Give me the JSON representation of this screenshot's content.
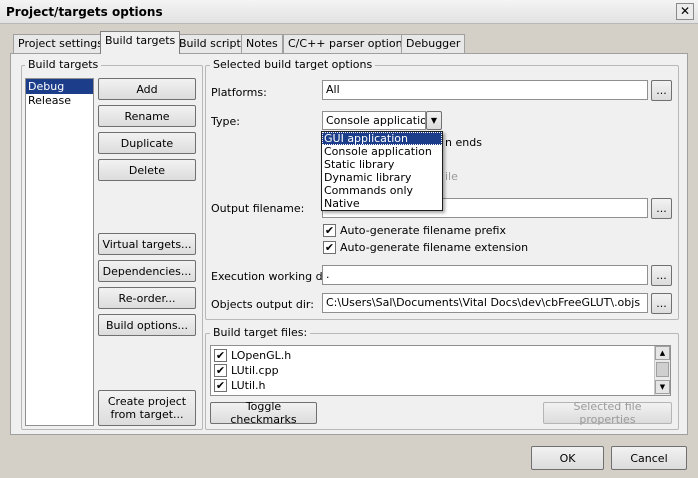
{
  "window": {
    "title": "Project/targets options",
    "close_glyph": "✕"
  },
  "tabs": [
    {
      "label": "Project settings"
    },
    {
      "label": "Build targets"
    },
    {
      "label": "Build scripts"
    },
    {
      "label": "Notes"
    },
    {
      "label": "C/C++ parser options"
    },
    {
      "label": "Debugger"
    }
  ],
  "build_targets": {
    "group_label": "Build targets",
    "items": [
      "Debug",
      "Release"
    ],
    "buttons": {
      "add": "Add",
      "rename": "Rename",
      "duplicate": "Duplicate",
      "delete": "Delete",
      "virtual_targets": "Virtual targets...",
      "dependencies": "Dependencies...",
      "reorder": "Re-order...",
      "build_options": "Build options...",
      "create_line1": "Create project",
      "create_line2": "from target..."
    }
  },
  "selected": {
    "group_label": "Selected build target options",
    "platforms_label": "Platforms:",
    "platforms_value": "All",
    "type_label": "Type:",
    "type_value": "Console application",
    "dropdown_options": [
      "GUI application",
      "Console application",
      "Static library",
      "Dynamic library",
      "Commands only",
      "Native"
    ],
    "partial_behind_1": "n ends",
    "partial_behind_2": "ile",
    "output_label": "Output filename:",
    "auto_prefix": "Auto-generate filename prefix",
    "auto_ext": "Auto-generate filename extension",
    "exec_label": "Execution working dir:",
    "exec_value": ".",
    "obj_label": "Objects output dir:",
    "obj_value": "C:\\Users\\Sal\\Documents\\Vital Docs\\dev\\cbFreeGLUT\\.objs",
    "ellipsis": "..."
  },
  "files": {
    "group_label": "Build target files:",
    "items": [
      "LOpenGL.h",
      "LUtil.cpp",
      "LUtil.h"
    ],
    "toggle": "Toggle checkmarks",
    "props": "Selected file properties"
  },
  "footer": {
    "ok": "OK",
    "cancel": "Cancel"
  },
  "glyphs": {
    "check": "✔",
    "down": "▼",
    "up": "▲"
  }
}
